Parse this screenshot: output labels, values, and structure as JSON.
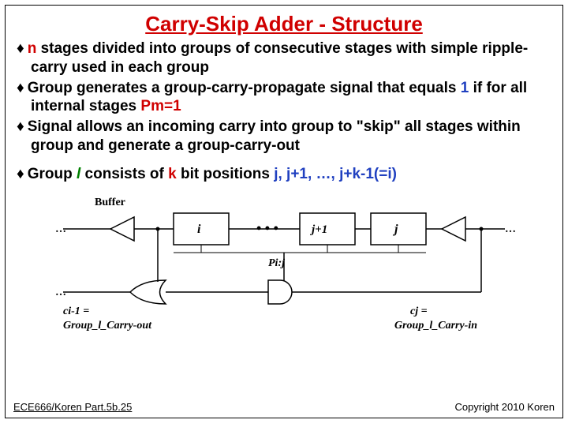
{
  "title": "Carry-Skip Adder - Structure",
  "bullets": {
    "b1_n": "n",
    "b1_rest": " stages divided into groups of consecutive stages with simple ripple-carry used in each group",
    "b2_a": "Group generates a group-carry-propagate signal that equals ",
    "b2_one": "1",
    "b2_b": " if for all internal stages ",
    "b2_pm": "Pm",
    "b2_eq1": "=1",
    "b3": "Signal allows an incoming carry into group to \"skip\" all stages within group and generate a group-carry-out",
    "b4_a": "Group ",
    "b4_l": "l",
    "b4_b": " consists of ",
    "b4_k": "k",
    "b4_c": " bit positions ",
    "b4_j": "j, j+1, …, j+k-1(=i)"
  },
  "diagram": {
    "buffer": "Buffer",
    "dots": "• • •",
    "box_i": "i",
    "box_j1": "j+1",
    "box_j": "j",
    "pij": "Pi:j",
    "ci_minus": "ci-1 =",
    "cj": "cj =",
    "group_out": "Group_l_Carry-out",
    "group_in": "Group_l_Carry-in",
    "ellipsis": "…"
  },
  "footer": {
    "left": "ECE666/Koren Part.5b.25",
    "right": "Copyright 2010 Koren"
  }
}
